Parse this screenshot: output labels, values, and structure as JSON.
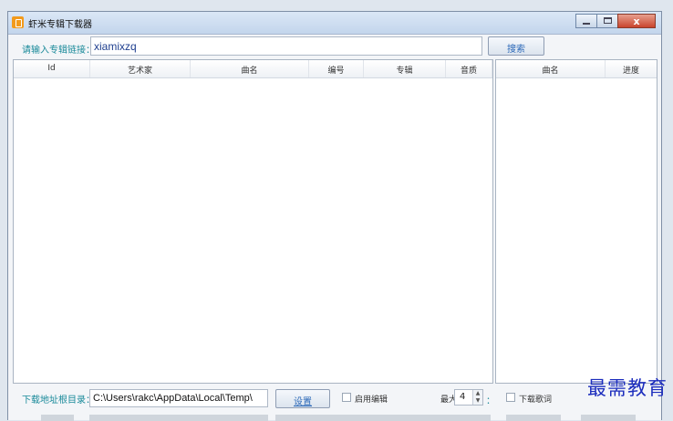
{
  "window": {
    "title": "虾米专辑下载器",
    "buttons": {
      "minimize": "minimize",
      "maximize": "maximize",
      "close": "x"
    }
  },
  "url_row": {
    "label": "请输入专辑链接：",
    "value": "xiamixzq",
    "search_label": "搜索"
  },
  "main_table": {
    "columns": [
      "Id",
      "艺术家",
      "曲名",
      "编号",
      "专辑",
      "音质"
    ],
    "rows": []
  },
  "side_table": {
    "columns": [
      "曲名",
      "进度"
    ],
    "rows": []
  },
  "footer": {
    "path_label": "下载地址根目录：",
    "path_value": "C:\\Users\\rakc\\AppData\\Local\\Temp\\",
    "set_label": "设置",
    "enable_edit_label": "启用编辑",
    "thread_label": "最大",
    "thread_value": "4",
    "thread_suffix": "：",
    "download_lyrics_label": "下载歌词"
  },
  "watermark": "最需教育",
  "colors": {
    "accent": "#1a8a9a",
    "link": "#2b68b8",
    "watermark": "#1c2dbd"
  }
}
